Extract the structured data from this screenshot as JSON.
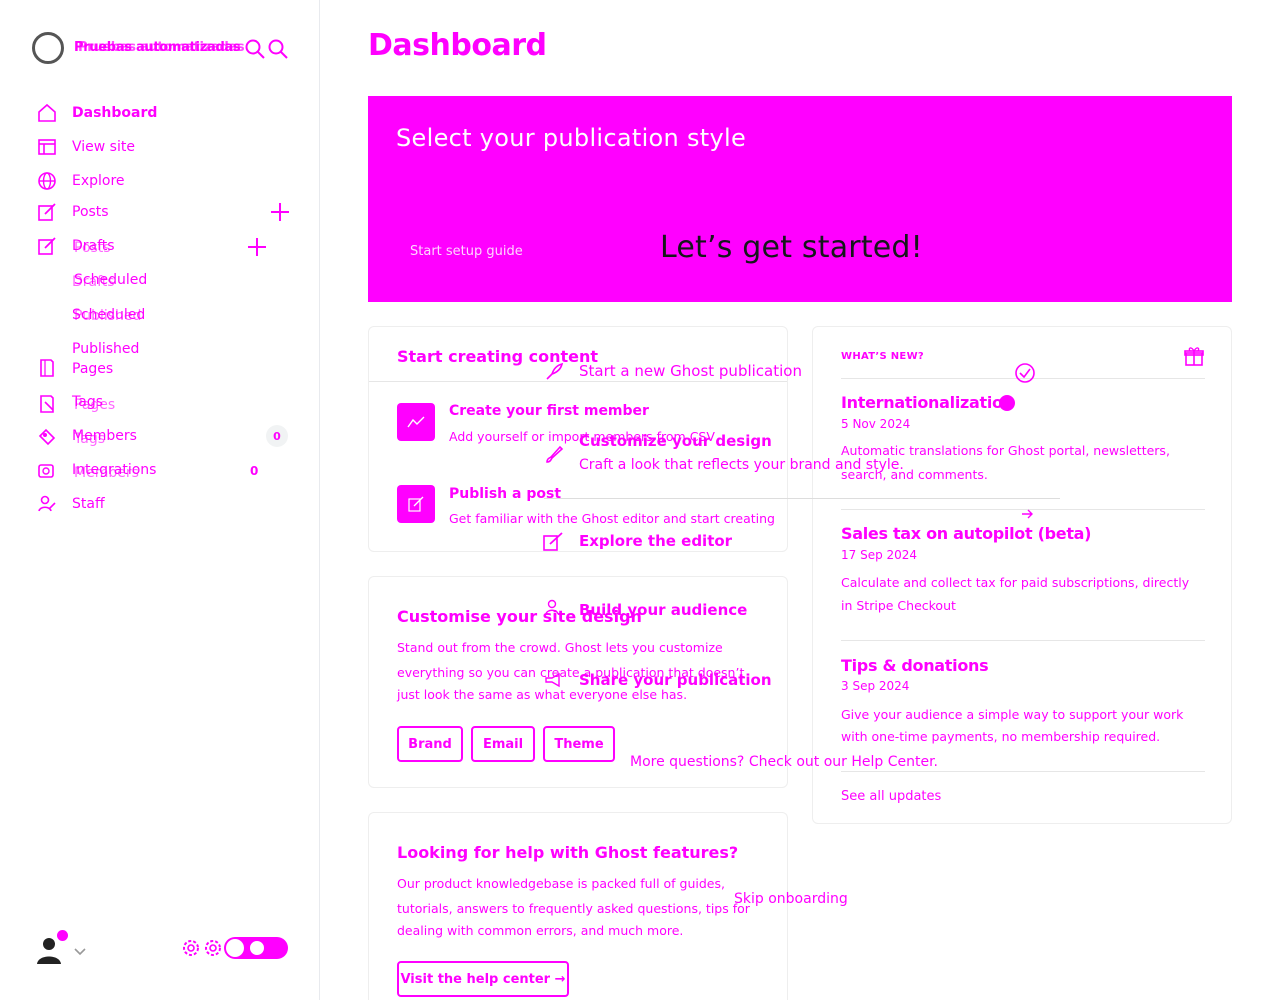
{
  "site": {
    "name_line_a": "Pruebas automatizadas",
    "name_line_b": "Pruebas automatizadas"
  },
  "sidebar": {
    "items": [
      {
        "label": "Dashboard",
        "icon": "home-icon"
      },
      {
        "label": "View site",
        "icon": "layout-icon"
      },
      {
        "label": "Explore",
        "icon": "globe-icon"
      },
      {
        "label": "Posts",
        "icon": "pencil-icon"
      },
      {
        "label": "Drafts",
        "icon": "pencil-icon"
      },
      {
        "label": "Scheduled",
        "icon": ""
      },
      {
        "label": "Published",
        "icon": ""
      },
      {
        "label": "Pages",
        "icon": "page-icon"
      },
      {
        "label": "Tags",
        "icon": "tag-icon"
      },
      {
        "label": "Members",
        "icon": "members-icon"
      },
      {
        "label": "Integrations",
        "icon": "integrations-icon"
      },
      {
        "label": "Staff",
        "icon": "staff-icon"
      }
    ],
    "ghost_labels": {
      "drafts": "Drafts",
      "scheduled": "Scheduled",
      "published": "Published",
      "pages": "Pages",
      "tags": "Tags",
      "members": "Members"
    },
    "members_count": "0",
    "integrations_count": "0"
  },
  "main": {
    "title": "Dashboard",
    "banner": {
      "heading": "Select your publication style",
      "setup_link": "Start setup guide",
      "cta": "Let’s get started!"
    },
    "start_card": {
      "title": "Start creating content",
      "items": [
        {
          "title": "Create your first member",
          "desc": "Add yourself or import members from CSV"
        },
        {
          "title": "Publish a post",
          "desc": "Get familiar with the Ghost editor and start creating"
        }
      ]
    },
    "customise_card": {
      "title": "Customise your site design",
      "body_1": "Stand out from the crowd. Ghost lets you customize",
      "body_2": "everything so you can create a publication that doesn’t",
      "body_3": "just look the same as what everyone else has.",
      "buttons": [
        "Brand",
        "Email",
        "Theme"
      ]
    },
    "help_card": {
      "title": "Looking for help with Ghost features?",
      "body_1": "Our product knowledgebase is packed full of guides,",
      "body_2": "tutorials, answers to frequently asked questions, tips for",
      "body_3": "dealing with common errors, and much more.",
      "button": "Visit the help center →"
    },
    "whats_new": {
      "label": "WHAT’S NEW?",
      "entries": [
        {
          "title": "Internationalization",
          "date": "5 Nov 2024",
          "desc_1": "Automatic translations for Ghost portal, newsletters,",
          "desc_2": "search, and comments."
        },
        {
          "title": "Sales tax on autopilot (beta)",
          "date": "17 Sep 2024",
          "desc_1": "Calculate and collect tax for paid subscriptions, directly",
          "desc_2": "in Stripe Checkout"
        },
        {
          "title": "Tips & donations",
          "date": "3 Sep 2024",
          "desc_1": "Give your audience a simple way to support your work",
          "desc_2": "with one-time payments, no membership required."
        }
      ],
      "see_all": "See all updates"
    },
    "overlay": {
      "start_new": "Start a new Ghost publication",
      "customize_design": "Customize your design",
      "craft_look": "Craft a look that reflects your brand and style.",
      "explore_editor": "Explore the editor",
      "build_audience": "Build your audience",
      "share_pub": "Share your publication",
      "more_questions": "More questions? Check out our Help Center.",
      "skip": "Skip onboarding"
    }
  },
  "colors": {
    "accent": "#ff00ff",
    "text_dark": "#15171a",
    "banner": "#ff00ff"
  }
}
